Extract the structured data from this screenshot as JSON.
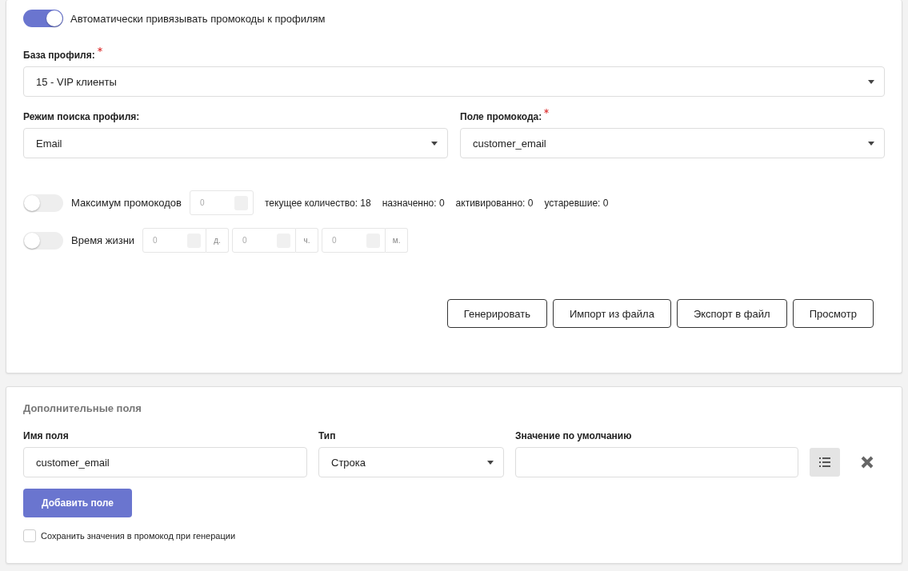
{
  "auto_bind": {
    "label": "Автоматически привязывать промокоды к профилям",
    "on": true
  },
  "profile_base": {
    "label": "База профиля:",
    "required": true,
    "value": "15 - VIP клиенты"
  },
  "search_mode": {
    "label": "Режим поиска профиля:",
    "required": false,
    "value": "Email"
  },
  "promo_field": {
    "label": "Поле промокода:",
    "required": true,
    "value": "customer_email"
  },
  "max_codes": {
    "label": "Максимум промокодов",
    "on": false,
    "placeholder": "0",
    "stats": [
      "текущее количество: 18",
      "назначенно: 0",
      "активированно: 0",
      "устаревшие: 0"
    ]
  },
  "lifetime": {
    "label": "Время жизни",
    "on": false,
    "parts": [
      {
        "placeholder": "0",
        "unit": "д."
      },
      {
        "placeholder": "0",
        "unit": "ч."
      },
      {
        "placeholder": "0",
        "unit": "м."
      }
    ]
  },
  "actions": [
    "Генерировать",
    "Импорт из файла",
    "Экспорт в файл",
    "Просмотр"
  ],
  "extra_fields": {
    "title": "Дополнительные поля",
    "columns": [
      "Имя поля",
      "Тип",
      "Значение по умолчанию"
    ],
    "rows": [
      {
        "name": "customer_email",
        "type": "Строка"
      }
    ],
    "add_button": "Добавить поле",
    "save_values": {
      "label": "Сохранить значения в промокод при генерации",
      "checked": false
    }
  }
}
